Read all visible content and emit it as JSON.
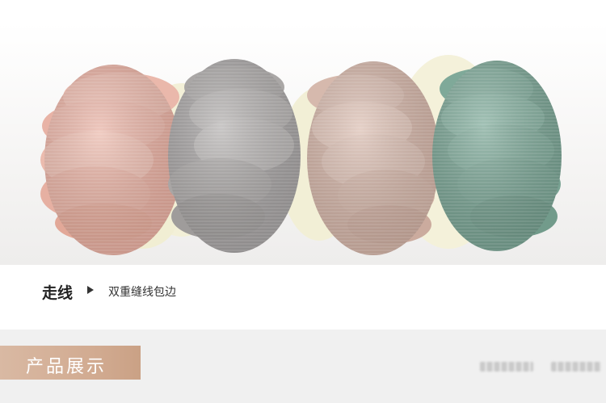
{
  "feature": {
    "title": "走线",
    "description": "双重缝线包边"
  },
  "section": {
    "label": "产品展示"
  },
  "colors": {
    "tab": "#d1aa90",
    "pink": "#e8b3a6",
    "gray": "#a7a4a4",
    "taupe": "#d3b6aa",
    "green": "#7aa596",
    "cream": "#f3f0d8"
  }
}
